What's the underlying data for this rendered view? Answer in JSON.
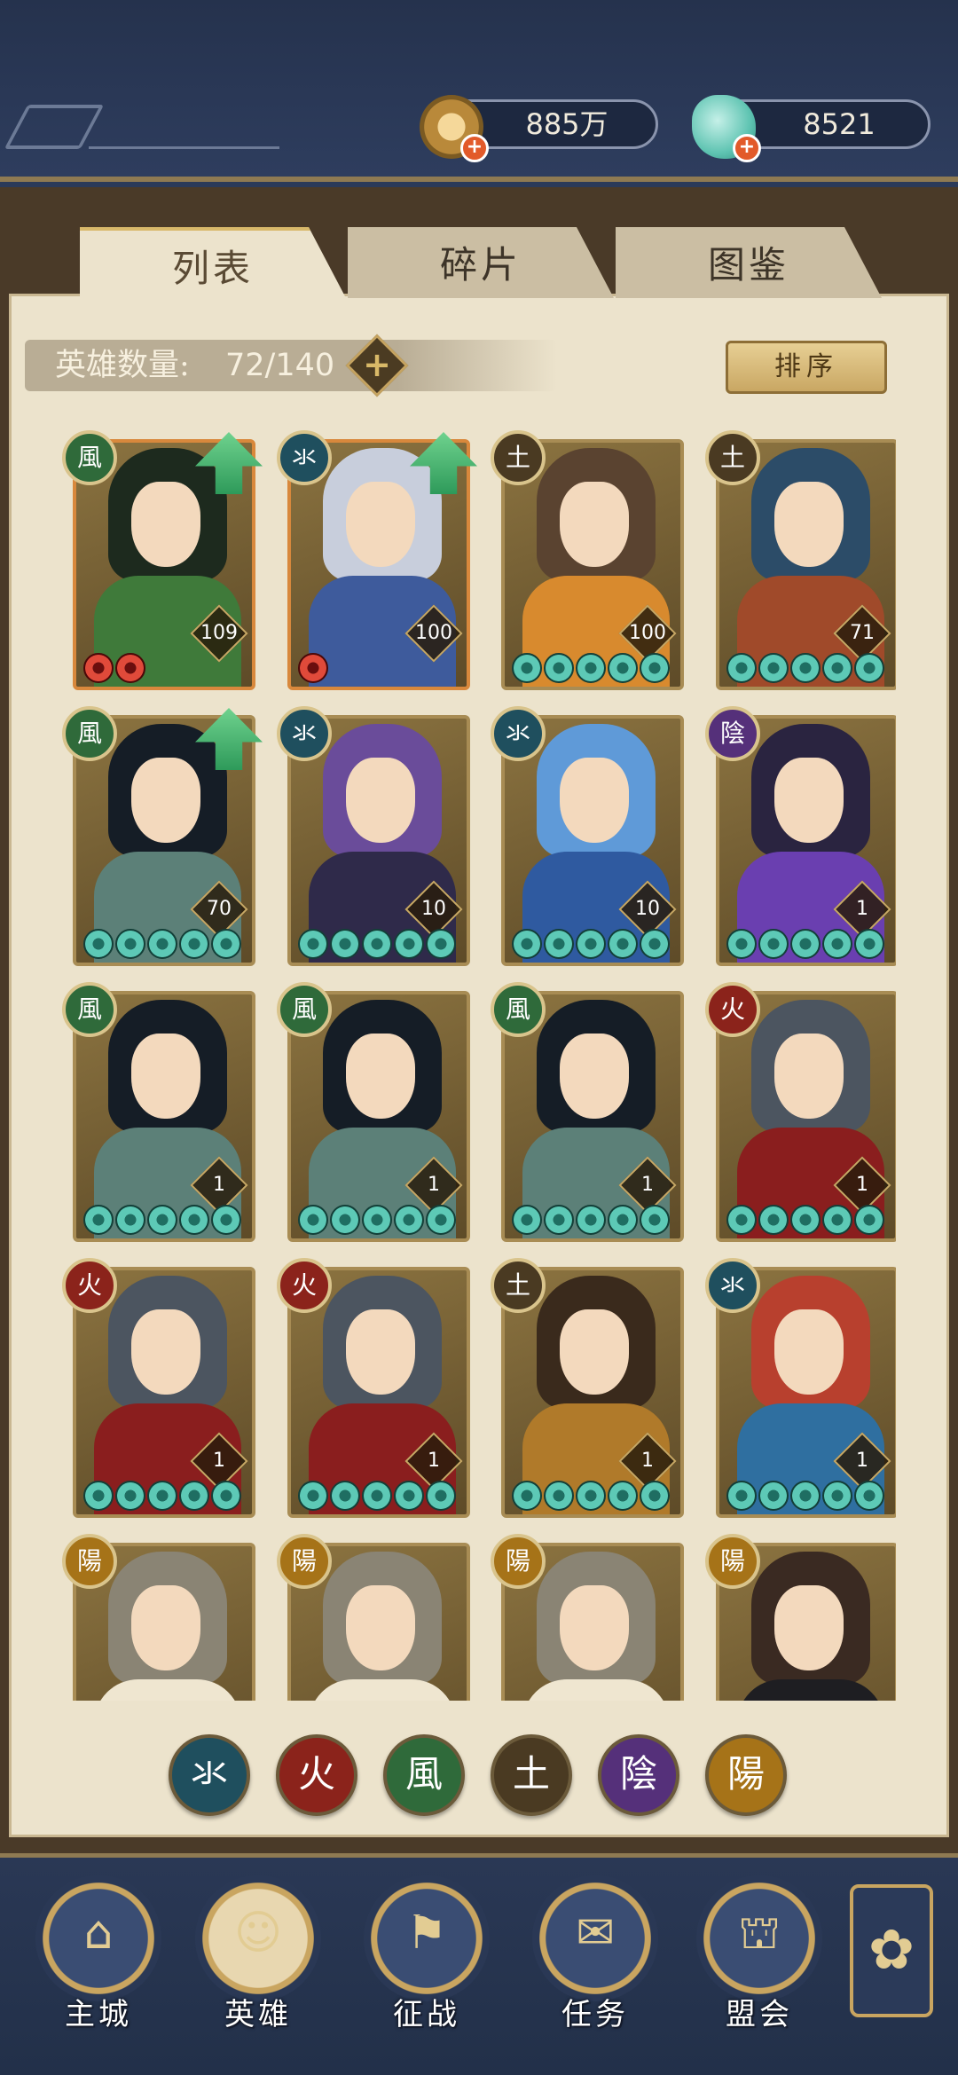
{
  "resources": {
    "gold": "885万",
    "jade": "8521"
  },
  "tabs": [
    {
      "label": "列表",
      "active": true
    },
    {
      "label": "碎片",
      "active": false
    },
    {
      "label": "图鉴",
      "active": false
    }
  ],
  "hero_count": {
    "label": "英雄数量:",
    "value": "72/140"
  },
  "sort_button": "排序",
  "element_glyphs": {
    "water": "氺",
    "fire": "火",
    "wind": "風",
    "earth": "土",
    "yin": "陰",
    "yang": "陽"
  },
  "heroes": [
    {
      "element": "wind",
      "level": "109",
      "stars": 2,
      "star_color": "red",
      "upgrade": true,
      "frame": "orange",
      "palette": [
        "#1d2a1e",
        "#3f7a3a"
      ]
    },
    {
      "element": "water",
      "level": "100",
      "stars": 1,
      "star_color": "red",
      "upgrade": true,
      "frame": "orange",
      "palette": [
        "#c8cedc",
        "#3e5b9c"
      ]
    },
    {
      "element": "earth",
      "level": "100",
      "stars": 5,
      "star_color": "jade",
      "upgrade": false,
      "frame": "gold",
      "palette": [
        "#5a4330",
        "#d88a2e"
      ]
    },
    {
      "element": "earth",
      "level": "71",
      "stars": 5,
      "star_color": "jade",
      "upgrade": false,
      "frame": "gold",
      "palette": [
        "#2c4c68",
        "#a04a2a"
      ]
    },
    {
      "element": "wind",
      "level": "70",
      "stars": 5,
      "star_color": "jade",
      "upgrade": true,
      "frame": "gold",
      "palette": [
        "#151d26",
        "#5c8078"
      ]
    },
    {
      "element": "water",
      "level": "10",
      "stars": 5,
      "star_color": "jade",
      "upgrade": false,
      "frame": "gold",
      "palette": [
        "#6a4c9a",
        "#2f2a4a"
      ]
    },
    {
      "element": "water",
      "level": "10",
      "stars": 5,
      "star_color": "jade",
      "upgrade": false,
      "frame": "gold",
      "palette": [
        "#5f9ad8",
        "#2f5aa0"
      ]
    },
    {
      "element": "yin",
      "level": "1",
      "stars": 5,
      "star_color": "jade",
      "upgrade": false,
      "frame": "gold",
      "palette": [
        "#2a2440",
        "#6a3fb0"
      ]
    },
    {
      "element": "wind",
      "level": "1",
      "stars": 5,
      "star_color": "jade",
      "upgrade": false,
      "frame": "gold",
      "palette": [
        "#151d26",
        "#5c8078"
      ]
    },
    {
      "element": "wind",
      "level": "1",
      "stars": 5,
      "star_color": "jade",
      "upgrade": false,
      "frame": "gold",
      "palette": [
        "#151d26",
        "#5c8078"
      ]
    },
    {
      "element": "wind",
      "level": "1",
      "stars": 5,
      "star_color": "jade",
      "upgrade": false,
      "frame": "gold",
      "palette": [
        "#151d26",
        "#5c8078"
      ]
    },
    {
      "element": "fire",
      "level": "1",
      "stars": 5,
      "star_color": "jade",
      "upgrade": false,
      "frame": "gold",
      "palette": [
        "#4c5560",
        "#8a1e1e"
      ]
    },
    {
      "element": "fire",
      "level": "1",
      "stars": 5,
      "star_color": "jade",
      "upgrade": false,
      "frame": "gold",
      "palette": [
        "#4c5560",
        "#8a1e1e"
      ]
    },
    {
      "element": "fire",
      "level": "1",
      "stars": 5,
      "star_color": "jade",
      "upgrade": false,
      "frame": "gold",
      "palette": [
        "#4c5560",
        "#8a1e1e"
      ]
    },
    {
      "element": "earth",
      "level": "1",
      "stars": 5,
      "star_color": "jade",
      "upgrade": false,
      "frame": "gold",
      "palette": [
        "#3a2a1c",
        "#b07a2a"
      ]
    },
    {
      "element": "water",
      "level": "1",
      "stars": 5,
      "star_color": "jade",
      "upgrade": false,
      "frame": "gold",
      "palette": [
        "#b8402e",
        "#2f6fa0"
      ]
    },
    {
      "element": "yang",
      "level": "",
      "stars": 0,
      "star_color": "jade",
      "upgrade": false,
      "frame": "gold",
      "palette": [
        "#8a8474",
        "#efe6d0"
      ]
    },
    {
      "element": "yang",
      "level": "",
      "stars": 0,
      "star_color": "jade",
      "upgrade": false,
      "frame": "gold",
      "palette": [
        "#8a8474",
        "#efe6d0"
      ]
    },
    {
      "element": "yang",
      "level": "",
      "stars": 0,
      "star_color": "jade",
      "upgrade": false,
      "frame": "gold",
      "palette": [
        "#8a8474",
        "#efe6d0"
      ]
    },
    {
      "element": "yang",
      "level": "",
      "stars": 0,
      "star_color": "jade",
      "upgrade": false,
      "frame": "gold",
      "palette": [
        "#3a2a22",
        "#1e1e22"
      ]
    }
  ],
  "filters": [
    {
      "element": "water",
      "glyph": "氺",
      "color": "#1f4f5e"
    },
    {
      "element": "fire",
      "glyph": "火",
      "color": "#8b231b"
    },
    {
      "element": "wind",
      "glyph": "風",
      "color": "#2f6a3a"
    },
    {
      "element": "earth",
      "glyph": "土",
      "color": "#4a3a22"
    },
    {
      "element": "yin",
      "glyph": "陰",
      "color": "#55307a"
    },
    {
      "element": "yang",
      "glyph": "陽",
      "color": "#a67318"
    }
  ],
  "bottom_nav": [
    {
      "label": "主城",
      "icon": "city-gate-icon",
      "active": false
    },
    {
      "label": "英雄",
      "icon": "hero-portrait-icon",
      "active": true
    },
    {
      "label": "征战",
      "icon": "war-drum-icon",
      "active": false
    },
    {
      "label": "任务",
      "icon": "scroll-icon",
      "active": false
    },
    {
      "label": "盟会",
      "icon": "alliance-hall-icon",
      "active": false
    }
  ]
}
